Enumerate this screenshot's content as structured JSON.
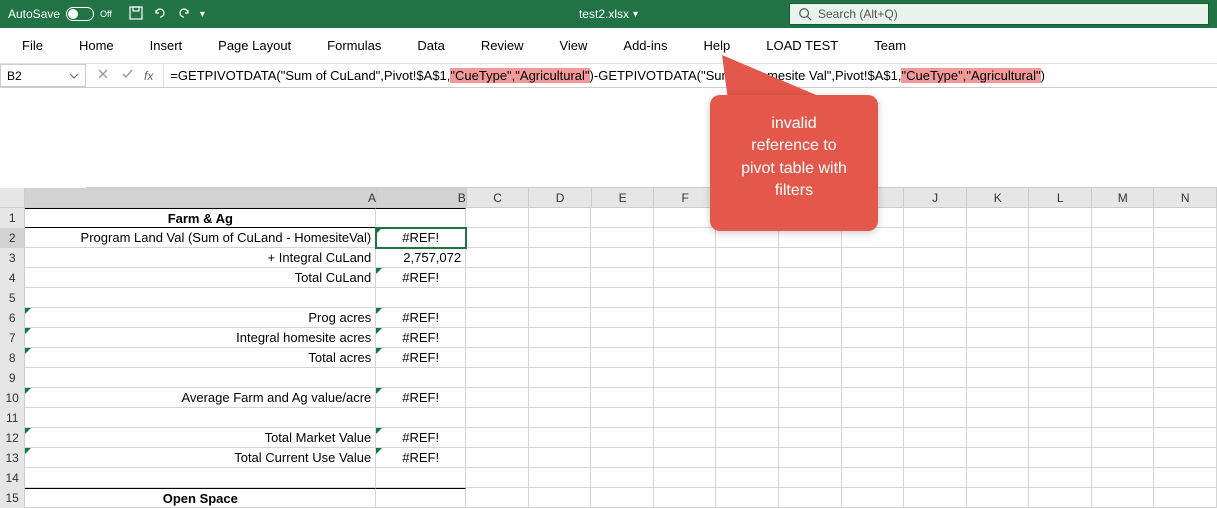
{
  "titlebar": {
    "autosave_label": "AutoSave",
    "autosave_state": "Off",
    "filename": "test2.xlsx",
    "search_placeholder": "Search (Alt+Q)"
  },
  "tabs": [
    "File",
    "Home",
    "Insert",
    "Page Layout",
    "Formulas",
    "Data",
    "Review",
    "View",
    "Add-ins",
    "Help",
    "LOAD TEST",
    "Team"
  ],
  "namebox": "B2",
  "formula": {
    "p1": "=GETPIVOTDATA(\"Sum of CuLand\",Pivot!$A$1,",
    "h1": "\"CueType\",\"Agricultural\"",
    "p2": ")-GETPIVOTDATA(\"Sum of Homesite Val\",Pivot!$A$1,",
    "h2": "\"CueType\",\"Agricultural\"",
    "p3": ")"
  },
  "callout": {
    "l1": "invalid",
    "l2": "reference to",
    "l3": "pivot table with",
    "l4": "filters"
  },
  "columns": [
    "A",
    "B",
    "C",
    "D",
    "E",
    "F",
    "G",
    "H",
    "I",
    "J",
    "K",
    "L",
    "M",
    "N"
  ],
  "rows": [
    {
      "n": "1",
      "a": "Farm & Ag",
      "b": "",
      "hdr": true
    },
    {
      "n": "2",
      "a": "Program Land Val (Sum of CuLand  -  HomesiteVal)",
      "b": "#REF!",
      "sel": true,
      "err": true
    },
    {
      "n": "3",
      "a": "+ Integral CuLand",
      "b": "2,757,072"
    },
    {
      "n": "4",
      "a": "Total CuLand",
      "b": "#REF!",
      "err": true
    },
    {
      "n": "5",
      "a": "",
      "b": ""
    },
    {
      "n": "6",
      "a": "Prog acres",
      "b": "#REF!",
      "err": true,
      "err_a": true
    },
    {
      "n": "7",
      "a": "Integral homesite acres",
      "b": "#REF!",
      "err": true,
      "err_a": true
    },
    {
      "n": "8",
      "a": "Total acres",
      "b": "#REF!",
      "err": true,
      "err_a": true
    },
    {
      "n": "9",
      "a": "",
      "b": ""
    },
    {
      "n": "10",
      "a": "Average Farm and Ag value/acre",
      "b": "#REF!",
      "err": true,
      "err_a": true
    },
    {
      "n": "11",
      "a": "",
      "b": ""
    },
    {
      "n": "12",
      "a": "Total Market Value",
      "b": "#REF!",
      "err": true,
      "err_a": true
    },
    {
      "n": "13",
      "a": "Total Current Use Value",
      "b": "#REF!",
      "err": true,
      "err_a": true
    },
    {
      "n": "14",
      "a": "",
      "b": ""
    },
    {
      "n": "15",
      "a": "Open Space",
      "b": "",
      "hdr2": true
    }
  ]
}
